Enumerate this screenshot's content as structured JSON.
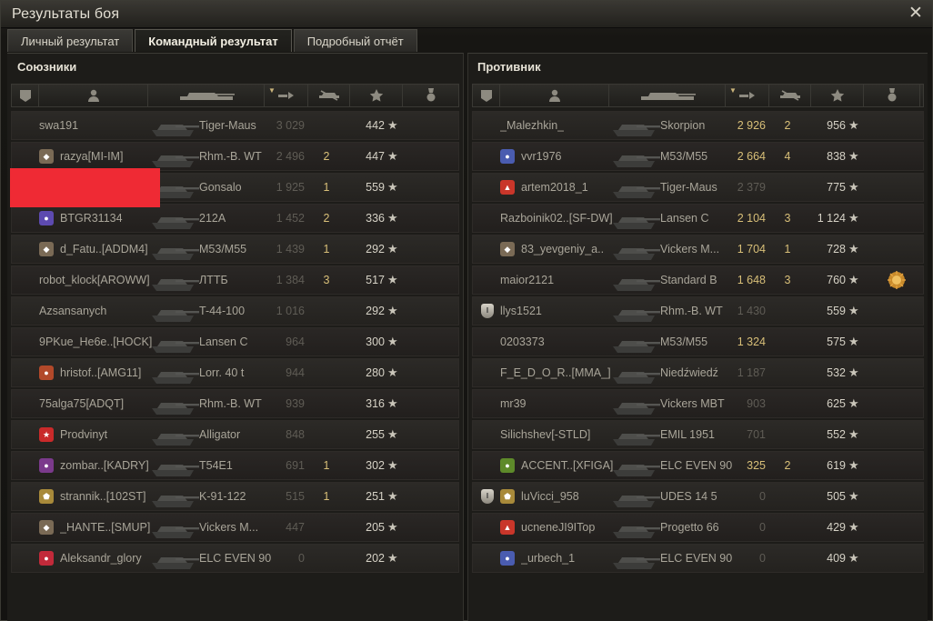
{
  "window": {
    "title": "Результаты боя",
    "close_glyph": "✕"
  },
  "tabs": [
    {
      "label": "Личный результат",
      "active": false
    },
    {
      "label": "Командный результат",
      "active": true
    },
    {
      "label": "Подробный отчёт",
      "active": false
    }
  ],
  "allies": {
    "title": "Союзники",
    "rows": [
      {
        "player": "swa191",
        "tank": "Tiger-Maus",
        "damage": "3 029",
        "kills": "",
        "xp": "442",
        "badge": "",
        "badge_color": ""
      },
      {
        "player": "razya[MI-IM]",
        "tank": "Rhm.-B. WT",
        "damage": "2 496",
        "kills": "2",
        "xp": "447",
        "badge": "diamond-icon",
        "badge_color": "#7a6a55"
      },
      {
        "player": "",
        "tank": "Gonsalo",
        "damage": "1 925",
        "kills": "1",
        "xp": "559",
        "badge": "",
        "badge_color": ""
      },
      {
        "player": "BTGR31134",
        "tank": "212A",
        "damage": "1 452",
        "kills": "2",
        "xp": "336",
        "badge": "clan-emblem-icon",
        "badge_color": "#5d4ab0"
      },
      {
        "player": "d_Fatu..[ADDM4]",
        "tank": "M53/M55",
        "damage": "1 439",
        "kills": "1",
        "xp": "292",
        "badge": "diamond-icon",
        "badge_color": "#7a6a55"
      },
      {
        "player": "robot_klock[AROWW]",
        "tank": "ЛТТБ",
        "damage": "1 384",
        "kills": "3",
        "xp": "517",
        "badge": "",
        "badge_color": ""
      },
      {
        "player": "Azsansanych",
        "tank": "T-44-100",
        "damage": "1 016",
        "kills": "",
        "xp": "292",
        "badge": "",
        "badge_color": ""
      },
      {
        "player": "9PKue_He6e..[HOCK]",
        "tank": "Lansen C",
        "damage": "964",
        "kills": "",
        "xp": "300",
        "badge": "",
        "badge_color": ""
      },
      {
        "player": "hristof..[AMG11]",
        "tank": "Lorr. 40 t",
        "damage": "944",
        "kills": "",
        "xp": "280",
        "badge": "clan-emblem-icon",
        "badge_color": "#b2492a"
      },
      {
        "player": "75alga75[ADQT]",
        "tank": "Rhm.-B. WT",
        "damage": "939",
        "kills": "",
        "xp": "316",
        "badge": "",
        "badge_color": ""
      },
      {
        "player": "Prodvinyt",
        "tank": "Alligator",
        "damage": "848",
        "kills": "",
        "xp": "255",
        "badge": "star-emblem-icon",
        "badge_color": "#c92a2a"
      },
      {
        "player": "zombar..[KADRY]",
        "tank": "T54E1",
        "damage": "691",
        "kills": "1",
        "xp": "302",
        "badge": "clan-emblem-icon",
        "badge_color": "#7b3a8c"
      },
      {
        "player": "strannik..[102ST]",
        "tank": "K-91-122",
        "damage": "515",
        "kills": "1",
        "xp": "251",
        "badge": "shield-emblem-icon",
        "badge_color": "#a88a3a"
      },
      {
        "player": "_HANTE..[SMUP]",
        "tank": "Vickers M...",
        "damage": "447",
        "kills": "",
        "xp": "205",
        "badge": "diamond-icon",
        "badge_color": "#7a6a55"
      },
      {
        "player": "Aleksandr_glory",
        "tank": "ELC EVEN 90",
        "damage": "0",
        "kills": "",
        "xp": "202",
        "badge": "clan-emblem-icon",
        "badge_color": "#c22a3a"
      }
    ]
  },
  "enemies": {
    "title": "Противник",
    "rows": [
      {
        "player": "_Malezhkin_",
        "tank": "Skorpion",
        "damage": "2 926",
        "kills": "2",
        "xp": "956",
        "badge": "",
        "badge_color": "",
        "rank": "",
        "medal": false
      },
      {
        "player": "vvr1976",
        "tank": "M53/M55",
        "damage": "2 664",
        "kills": "4",
        "xp": "838",
        "badge": "clan-emblem-icon",
        "badge_color": "#4a5cb0",
        "rank": "",
        "medal": false
      },
      {
        "player": "artem2018_1",
        "tank": "Tiger-Maus",
        "damage": "2 379",
        "kills": "",
        "xp": "775",
        "badge": "warning-triangle-icon",
        "badge_color": "#c9362a",
        "rank": "",
        "medal": false
      },
      {
        "player": "Razboinik02..[SF-DW]",
        "tank": "Lansen C",
        "damage": "2 104",
        "kills": "3",
        "xp": "1 124",
        "badge": "",
        "badge_color": "",
        "rank": "",
        "medal": false
      },
      {
        "player": "83_yevgeniy_a..",
        "tank": "Vickers M...",
        "damage": "1 704",
        "kills": "1",
        "xp": "728",
        "badge": "diamond-icon",
        "badge_color": "#7a6a55",
        "rank": "",
        "medal": false
      },
      {
        "player": "maior2121",
        "tank": "Standard B",
        "damage": "1 648",
        "kills": "3",
        "xp": "760",
        "badge": "",
        "badge_color": "",
        "rank": "",
        "medal": true
      },
      {
        "player": "llys1521",
        "tank": "Rhm.-B. WT",
        "damage": "1 430",
        "kills": "",
        "xp": "559",
        "badge": "",
        "badge_color": "",
        "rank": "I",
        "medal": false
      },
      {
        "player": "0203373",
        "tank": "M53/M55",
        "damage": "1 324",
        "kills": "",
        "xp": "575",
        "badge": "",
        "badge_color": "",
        "rank": "",
        "medal": false
      },
      {
        "player": "F_E_D_O_R..[MMA_]",
        "tank": "Niedźwiedź",
        "damage": "1 187",
        "kills": "",
        "xp": "532",
        "badge": "",
        "badge_color": "",
        "rank": "",
        "medal": false
      },
      {
        "player": "mr39",
        "tank": "Vickers MBT",
        "damage": "903",
        "kills": "",
        "xp": "625",
        "badge": "",
        "badge_color": "",
        "rank": "",
        "medal": false
      },
      {
        "player": "Silichshev[-STLD]",
        "tank": "EMIL 1951",
        "damage": "701",
        "kills": "",
        "xp": "552",
        "badge": "",
        "badge_color": "",
        "rank": "",
        "medal": false
      },
      {
        "player": "ACCENT..[XFIGA]",
        "tank": "ELC EVEN 90",
        "damage": "325",
        "kills": "2",
        "xp": "619",
        "badge": "clan-emblem-icon",
        "badge_color": "#5e8a2a",
        "rank": "",
        "medal": false
      },
      {
        "player": "luVicci_958",
        "tank": "UDES 14 5",
        "damage": "0",
        "kills": "",
        "xp": "505",
        "badge": "shield-emblem-icon",
        "badge_color": "#a88a3a",
        "rank": "I",
        "medal": false
      },
      {
        "player": "ucneneJI9ITop",
        "tank": "Progetto 66",
        "damage": "0",
        "kills": "",
        "xp": "429",
        "badge": "warning-triangle-icon",
        "badge_color": "#c9362a",
        "rank": "",
        "medal": false
      },
      {
        "player": "_urbech_1",
        "tank": "ELC EVEN 90",
        "damage": "0",
        "kills": "",
        "xp": "409",
        "badge": "clan-emblem-icon",
        "badge_color": "#4a5cb0",
        "rank": "",
        "medal": false
      }
    ]
  },
  "colors": {
    "accent_gold": "#d8bf78",
    "redaction": "#ef2a34"
  }
}
